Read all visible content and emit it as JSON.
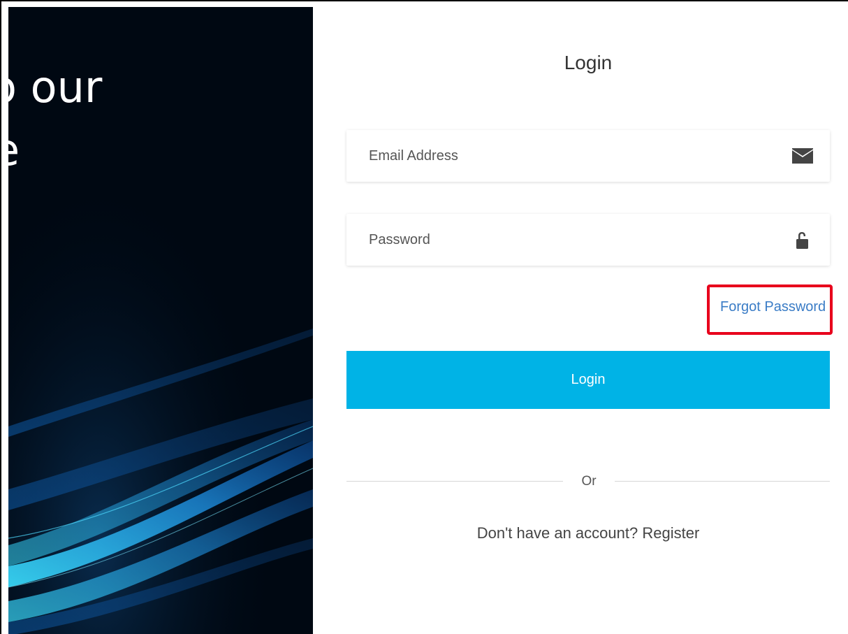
{
  "hero": {
    "line1": "o our",
    "line2": "e"
  },
  "form": {
    "title": "Login",
    "email": {
      "placeholder": "Email Address",
      "value": ""
    },
    "password": {
      "placeholder": "Password",
      "value": ""
    },
    "forgot_label": "Forgot Password",
    "login_label": "Login",
    "divider_label": "Or",
    "register_prompt": "Don't have an account?",
    "register_link": "Register"
  },
  "icons": {
    "email": "envelope-icon",
    "password": "unlock-icon"
  },
  "colors": {
    "accent": "#00b3e6",
    "link": "#3a7cc6",
    "highlight": "#e8001c",
    "hero_bg": "#000812"
  }
}
